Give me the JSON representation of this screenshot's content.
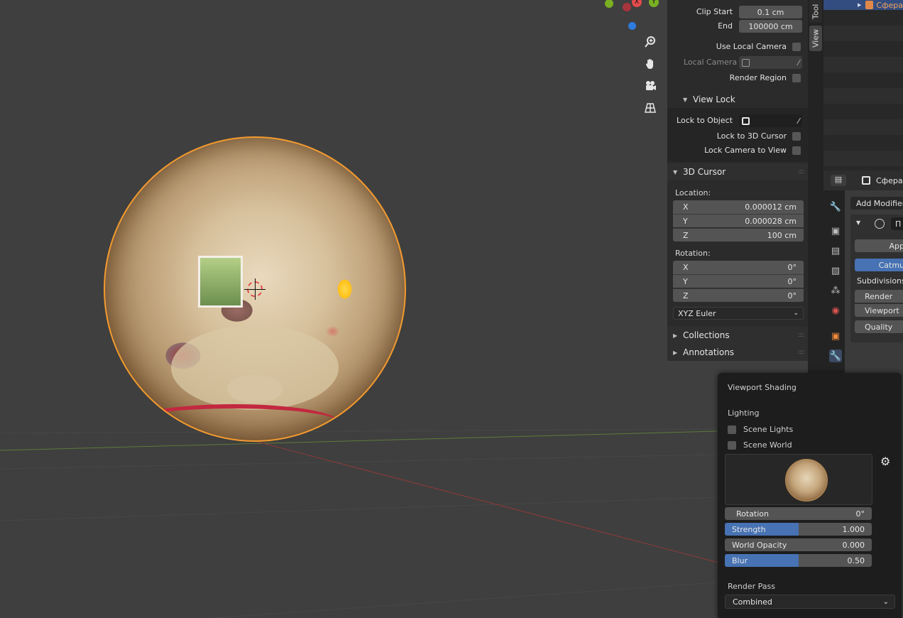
{
  "view_panel": {
    "clip_start_label": "Clip Start",
    "clip_start_value": "0.1 cm",
    "end_label": "End",
    "end_value": "100000 cm",
    "use_local_camera_label": "Use Local Camera",
    "local_camera_label": "Local Camera",
    "render_region_label": "Render Region",
    "view_lock_header": "View Lock",
    "lock_to_object_label": "Lock to Object",
    "lock_to_3d_cursor_label": "Lock to 3D Cursor",
    "lock_camera_to_view_label": "Lock Camera to View"
  },
  "cursor_panel": {
    "header": "3D Cursor",
    "location_label": "Location:",
    "location": [
      {
        "axis": "X",
        "value": "0.000012 cm"
      },
      {
        "axis": "Y",
        "value": "0.000028 cm"
      },
      {
        "axis": "Z",
        "value": "100 cm"
      }
    ],
    "rotation_label": "Rotation:",
    "rotation": [
      {
        "axis": "X",
        "value": "0°"
      },
      {
        "axis": "Y",
        "value": "0°"
      },
      {
        "axis": "Z",
        "value": "0°"
      }
    ],
    "rotation_mode": "XYZ Euler"
  },
  "collapsed_sections": {
    "collections": "Collections",
    "annotations": "Annotations"
  },
  "tabs": {
    "tool": "Tool",
    "view": "View"
  },
  "outliner": {
    "object_name": "Сфера"
  },
  "properties": {
    "object_name": "Сфера",
    "add_modifier": "Add Modifier",
    "modifier_name": "П",
    "apply_label": "App",
    "catmull_label": "Catmu",
    "subdivisions_label": "Subdivisions:",
    "render_label": "Render",
    "viewport_label": "Viewport",
    "quality_label": "Quality"
  },
  "shading": {
    "title": "Viewport Shading",
    "lighting_label": "Lighting",
    "scene_lights_label": "Scene Lights",
    "scene_world_label": "Scene World",
    "rotation_label": "Rotation",
    "rotation_value": "0°",
    "strength_label": "Strength",
    "strength_value": "1.000",
    "strength_fraction": 0.5,
    "world_opacity_label": "World Opacity",
    "world_opacity_value": "0.000",
    "blur_label": "Blur",
    "blur_value": "0.50",
    "blur_fraction": 0.5,
    "render_pass_label": "Render Pass",
    "render_pass_value": "Combined"
  },
  "gizmo": {
    "x_label": "X",
    "y_label": "Y"
  },
  "colors": {
    "accent_blue": "#4772b3",
    "selection_orange": "#f29a2e",
    "x_axis": "#e34b4b",
    "y_axis": "#7ab022",
    "z_axis": "#2f7be0"
  }
}
